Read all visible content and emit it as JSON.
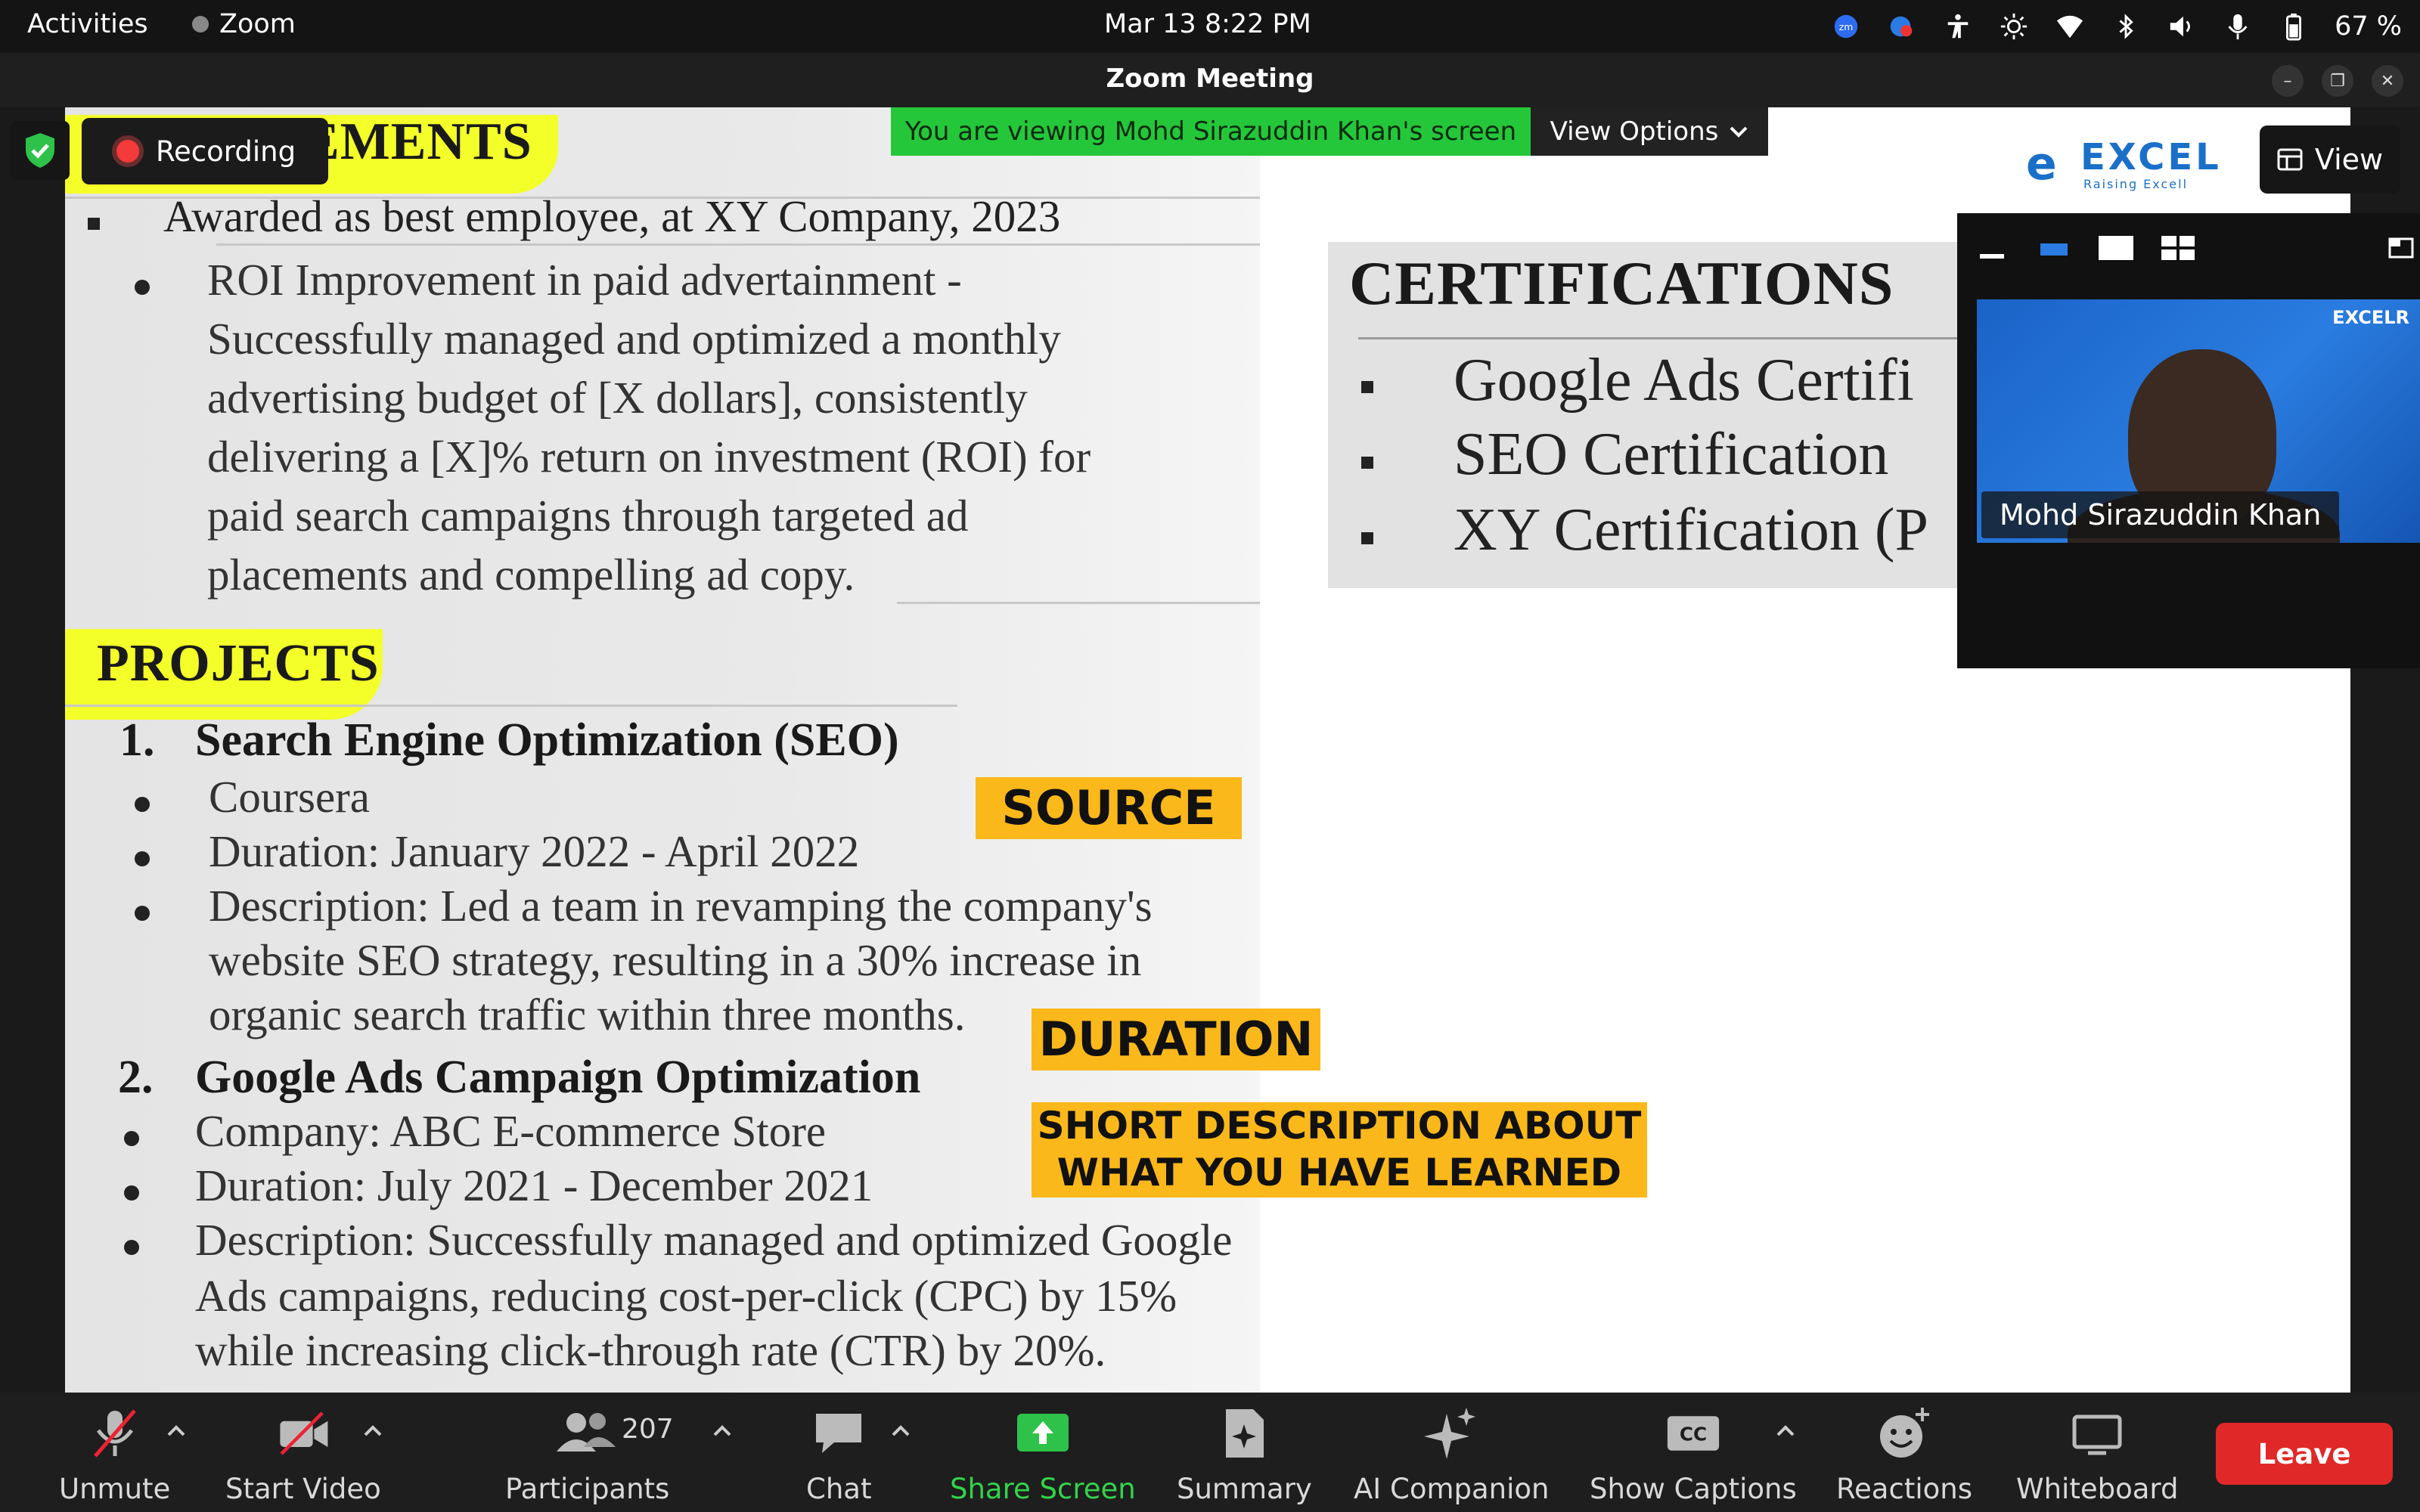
{
  "topbar": {
    "activities": "Activities",
    "app_name": "Zoom",
    "clock": "Mar 13   8:22 PM",
    "battery": "67 %"
  },
  "window": {
    "title": "Zoom Meeting"
  },
  "share": {
    "recording_label": "Recording",
    "viewing_banner": "You are viewing Mohd Sirazuddin Khan's screen",
    "view_options": "View Options",
    "view_button": "View"
  },
  "document": {
    "achievements_heading": "ACHIEVEMENTS",
    "award_line": "Awarded as best employee, at XY Company, 2023",
    "roi_lines": [
      "ROI Improvement in paid advertainment -",
      "Successfully managed and optimized a monthly",
      "advertising budget of [X dollars], consistently",
      "delivering a [X]% return on investment (ROI) for",
      "paid search campaigns through targeted ad",
      "placements and compelling ad copy."
    ],
    "projects_heading": "PROJECTS",
    "project1_number": "1.",
    "project1_title": "Search Engine Optimization (SEO)",
    "project1_items": [
      "Coursera",
      "Duration: January 2022 - April 2022",
      "Description: Led a team in revamping the company's",
      "website SEO strategy, resulting in a 30% increase in",
      "organic search traffic within three months."
    ],
    "project2_number": "2.",
    "project2_title": "Google Ads Campaign Optimization",
    "project2_items": [
      "Company: ABC E-commerce Store",
      "Duration: July 2021 - December 2021",
      "Description: Successfully managed and optimized Google",
      "Ads campaigns, reducing cost-per-click (CPC) by 15%",
      "while increasing click-through rate (CTR) by 20%."
    ],
    "certifications_heading": "CERTIFICATIONS",
    "certifications": [
      "Google Ads Certifi",
      "SEO Certification",
      "XY Certification (P"
    ],
    "stickers": {
      "source": "SOURCE",
      "duration": "DURATION",
      "short_desc_1": "SHORT DESCRIPTION ABOUT",
      "short_desc_2": "WHAT YOU HAVE LEARNED"
    },
    "logo_mark": "e",
    "logo_word": "EXCEL",
    "logo_tag": "Raising Excell"
  },
  "video": {
    "participant_name": "Mohd Sirazuddin Khan",
    "tile_logo": "EXCELR"
  },
  "toolbar": {
    "unmute": "Unmute",
    "start_video": "Start Video",
    "participants": "Participants",
    "participants_count": "207",
    "chat": "Chat",
    "share_screen": "Share Screen",
    "summary": "Summary",
    "ai_companion": "AI Companion",
    "show_captions": "Show Captions",
    "captions_icon_text": "CC",
    "reactions": "Reactions",
    "whiteboard": "Whiteboard",
    "leave": "Leave"
  },
  "colors": {
    "share_green": "#25c73a",
    "leave_red": "#e02828",
    "highlight_yellow": "#f4ff2a",
    "sticker_orange": "#fbb81b",
    "excelr_blue": "#1a70c8"
  }
}
